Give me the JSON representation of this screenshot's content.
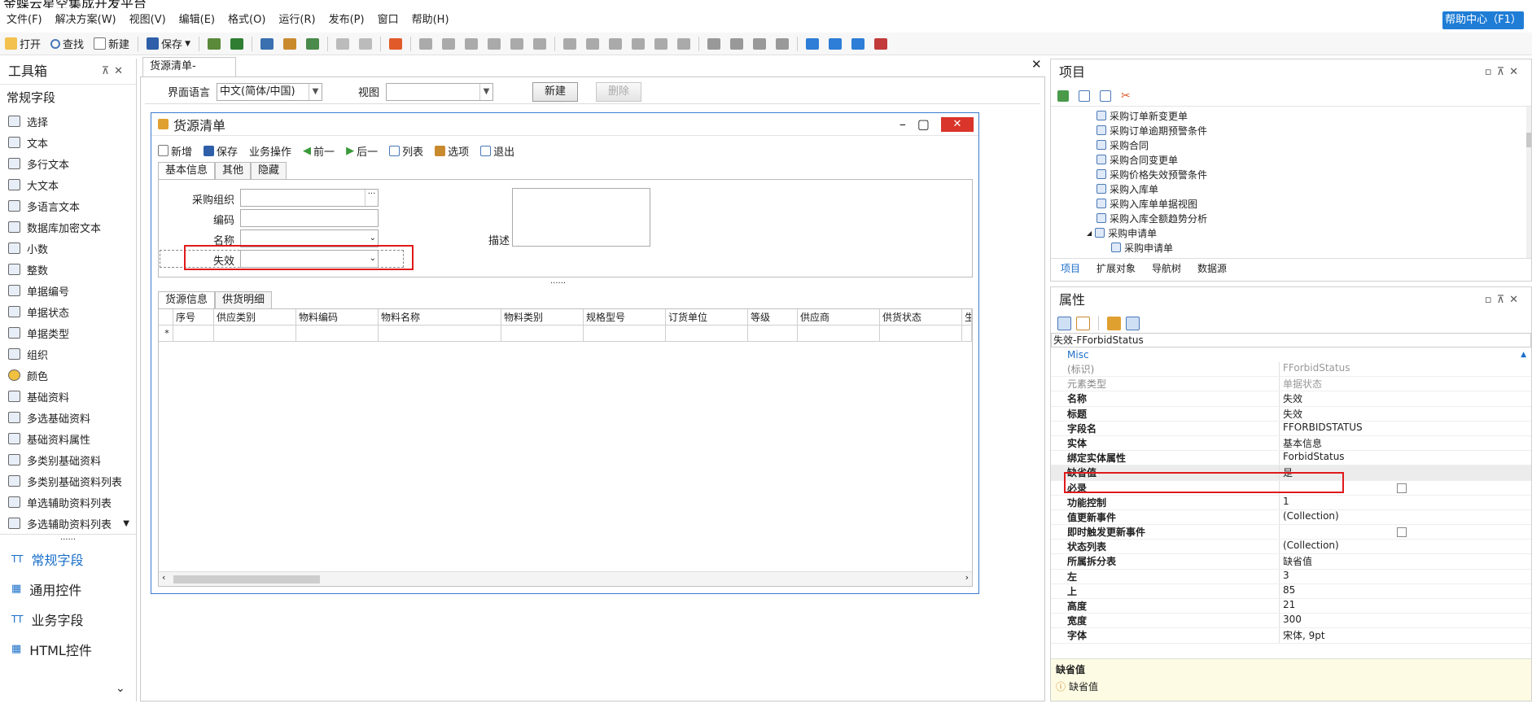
{
  "app": {
    "title": "金蝶云星空集成开发平台"
  },
  "menu": [
    "文件(F)",
    "解决方案(W)",
    "视图(V)",
    "编辑(E)",
    "格式(O)",
    "运行(R)",
    "发布(P)",
    "窗口",
    "帮助(H)"
  ],
  "help_center": "帮助中心（F1）",
  "toolbar": {
    "open": "打开",
    "find": "查找",
    "new": "新建",
    "save": "保存"
  },
  "toolbox": {
    "title": "工具箱",
    "section": "常规字段",
    "items": [
      "选择",
      "文本",
      "多行文本",
      "大文本",
      "多语言文本",
      "数据库加密文本",
      "小数",
      "整数",
      "单据编号",
      "单据状态",
      "单据类型",
      "组织",
      "颜色",
      "基础资料",
      "多选基础资料",
      "基础资料属性",
      "多类别基础资料",
      "多类别基础资料列表",
      "单选辅助资料列表",
      "多选辅助资料列表"
    ],
    "dots": "......",
    "categories": [
      "常规字段",
      "通用控件",
      "业务字段",
      "HTML控件"
    ]
  },
  "doc": {
    "tab": "货源清单-_Default",
    "lang_label": "界面语言",
    "lang_value": "中文(简体/中国)",
    "view_label": "视图",
    "view_value": "",
    "new_btn": "新建",
    "delete_btn": "删除"
  },
  "form": {
    "title": "货源清单",
    "toolbar": [
      "新增",
      "保存",
      "业务操作",
      "前一",
      "后一",
      "列表",
      "选项",
      "退出"
    ],
    "tabs": [
      "基本信息",
      "其他",
      "隐藏"
    ],
    "fields": {
      "org": "采购组织",
      "code": "编码",
      "name": "名称",
      "forbid": "失效",
      "desc": "描述"
    },
    "splitter": "......",
    "grid_tabs": [
      "货源信息",
      "供货明细"
    ],
    "columns": [
      "序号",
      "供应类别",
      "物料编码",
      "物料名称",
      "物料类别",
      "规格型号",
      "订货单位",
      "等级",
      "供应商",
      "供货状态",
      "生效"
    ],
    "new_row_marker": "*"
  },
  "project": {
    "title": "项目",
    "tree": [
      "采购订单新变更单",
      "采购订单逾期预警条件",
      "采购合同",
      "采购合同变更单",
      "采购价格失效预警条件",
      "采购入库单",
      "采购入库单单据视图",
      "采购入库全额趋势分析",
      "采购申请单",
      "采购申请单"
    ],
    "tabs": [
      "项目",
      "扩展对象",
      "导航树",
      "数据源"
    ]
  },
  "properties": {
    "title": "属性",
    "object": "失效-FForbidStatus",
    "category": "Misc",
    "rows": [
      {
        "name": "(标识)",
        "value": "FForbidStatus",
        "readonly": true
      },
      {
        "name": "元素类型",
        "value": "单据状态",
        "readonly": true
      },
      {
        "name": "名称",
        "value": "失效"
      },
      {
        "name": "标题",
        "value": "失效"
      },
      {
        "name": "字段名",
        "value": "FFORBIDSTATUS"
      },
      {
        "name": "实体",
        "value": "基本信息"
      },
      {
        "name": "绑定实体属性",
        "value": "ForbidStatus"
      },
      {
        "name": "缺省值",
        "value": "是"
      },
      {
        "name": "必录",
        "value": "",
        "checkbox": true
      },
      {
        "name": "功能控制",
        "value": "1"
      },
      {
        "name": "值更新事件",
        "value": "(Collection)"
      },
      {
        "name": "即时触发更新事件",
        "value": "",
        "checkbox": true
      },
      {
        "name": "状态列表",
        "value": "(Collection)"
      },
      {
        "name": "所属拆分表",
        "value": "缺省值"
      },
      {
        "name": "左",
        "value": "3"
      },
      {
        "name": "上",
        "value": "85"
      },
      {
        "name": "高度",
        "value": "21"
      },
      {
        "name": "宽度",
        "value": "300"
      },
      {
        "name": "字体",
        "value": "宋体, 9pt"
      }
    ],
    "desc_title": "缺省值",
    "desc_text": "缺省值"
  }
}
